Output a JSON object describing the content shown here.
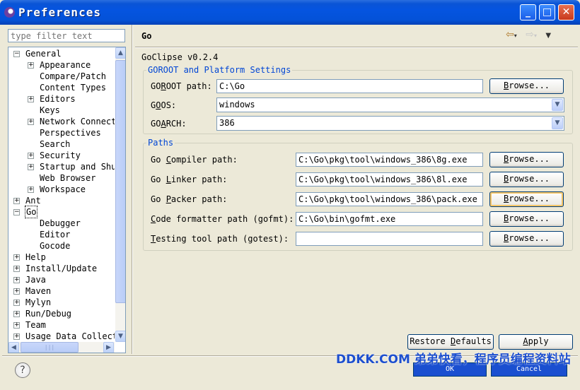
{
  "window": {
    "title": "Preferences"
  },
  "filter": {
    "placeholder": "type filter text"
  },
  "tree": {
    "items": [
      {
        "label": "General",
        "exp": "−",
        "level": 0
      },
      {
        "label": "Appearance",
        "exp": "+",
        "level": 1
      },
      {
        "label": "Compare/Patch",
        "exp": "",
        "level": 1
      },
      {
        "label": "Content Types",
        "exp": "",
        "level": 1
      },
      {
        "label": "Editors",
        "exp": "+",
        "level": 1
      },
      {
        "label": "Keys",
        "exp": "",
        "level": 1
      },
      {
        "label": "Network Connect",
        "exp": "+",
        "level": 1
      },
      {
        "label": "Perspectives",
        "exp": "",
        "level": 1
      },
      {
        "label": "Search",
        "exp": "",
        "level": 1
      },
      {
        "label": "Security",
        "exp": "+",
        "level": 1
      },
      {
        "label": "Startup and Shu",
        "exp": "+",
        "level": 1
      },
      {
        "label": "Web Browser",
        "exp": "",
        "level": 1
      },
      {
        "label": "Workspace",
        "exp": "+",
        "level": 1
      },
      {
        "label": "Ant",
        "exp": "+",
        "level": 0
      },
      {
        "label": "Go",
        "exp": "−",
        "level": 0,
        "selected": true
      },
      {
        "label": "Debugger",
        "exp": "",
        "level": 1
      },
      {
        "label": "Editor",
        "exp": "",
        "level": 1
      },
      {
        "label": "Gocode",
        "exp": "",
        "level": 1
      },
      {
        "label": "Help",
        "exp": "+",
        "level": 0
      },
      {
        "label": "Install/Update",
        "exp": "+",
        "level": 0
      },
      {
        "label": "Java",
        "exp": "+",
        "level": 0
      },
      {
        "label": "Maven",
        "exp": "+",
        "level": 0
      },
      {
        "label": "Mylyn",
        "exp": "+",
        "level": 0
      },
      {
        "label": "Run/Debug",
        "exp": "+",
        "level": 0
      },
      {
        "label": "Team",
        "exp": "+",
        "level": 0
      },
      {
        "label": "Usage Data Collect",
        "exp": "+",
        "level": 0
      }
    ]
  },
  "page": {
    "title": "Go",
    "version": "GoClipse v0.2.4",
    "goroot_group": {
      "legend": "GOROOT and Platform Settings",
      "goroot_label_pre": "GO",
      "goroot_label_u": "R",
      "goroot_label_post": "OOT path:",
      "goroot_value": "C:\\Go",
      "goos_label_pre": "G",
      "goos_label_u": "O",
      "goos_label_post": "OS:",
      "goos_value": "windows",
      "goarch_label_pre": "GO",
      "goarch_label_u": "A",
      "goarch_label_post": "RCH:",
      "goarch_value": "386"
    },
    "paths_group": {
      "legend": "Paths",
      "compiler_pre": "Go ",
      "compiler_u": "C",
      "compiler_post": "ompiler path:",
      "compiler_value": "C:\\Go\\pkg\\tool\\windows_386\\8g.exe",
      "linker_pre": "Go ",
      "linker_u": "L",
      "linker_post": "inker path:",
      "linker_value": "C:\\Go\\pkg\\tool\\windows_386\\8l.exe",
      "packer_pre": "Go ",
      "packer_u": "P",
      "packer_post": "acker path:",
      "packer_value": "C:\\Go\\pkg\\tool\\windows_386\\pack.exe",
      "formatter_pre": "",
      "formatter_u": "C",
      "formatter_post": "ode formatter path (gofmt):",
      "formatter_value": "C:\\Go\\bin\\gofmt.exe",
      "testing_pre": "",
      "testing_u": "T",
      "testing_post": "esting tool path (gotest):",
      "testing_value": ""
    },
    "browse_label_u": "B",
    "browse_label_post": "rowse...",
    "restore_pre": "Restore ",
    "restore_u": "D",
    "restore_post": "efaults",
    "apply_u": "A",
    "apply_post": "pply"
  },
  "footer": {
    "help_glyph": "?",
    "ok_label": "OK",
    "cancel_label": "Cancel"
  },
  "watermark": "DDKK.COM 弟弟快看，程序员编程资料站"
}
